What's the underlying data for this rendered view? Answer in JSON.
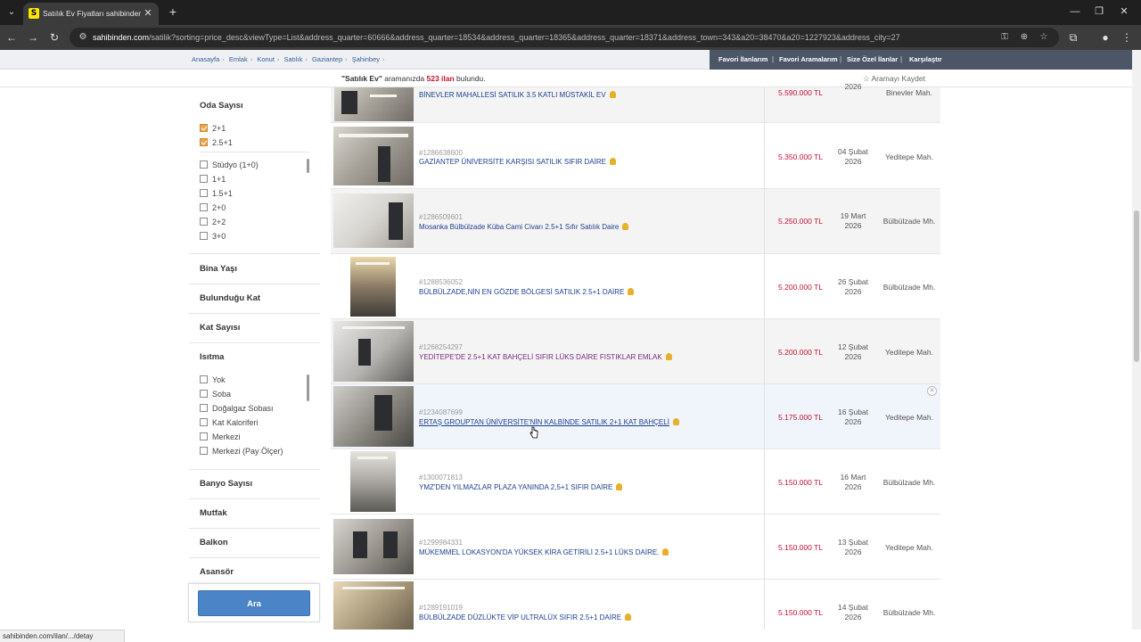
{
  "browser": {
    "tab_title": "Satılık Ev Fiyatları sahibinden.com",
    "url_host": "sahibinden.com",
    "url_rest": "/satilik?sorting=price_desc&viewType=List&address_quarter=60666&address_quarter=18534&address_quarter=18365&address_quarter=18371&address_town=343&a20=38470&a20=1227923&address_city=27",
    "status_url": "sahibinden.com/ilan/.../detay"
  },
  "breadcrumb": [
    "Anasayfa",
    "Emlak",
    "Konut",
    "Satılık",
    "Gaziantep",
    "Şahinbey"
  ],
  "user_links": [
    "Favori İlanlarım",
    "Favori Aramalarım",
    "Size Özel İlanlar",
    "Karşılaştır"
  ],
  "result": {
    "query": "\"Satılık Ev\"",
    "mid": " aramanızda ",
    "count": "523 ilan",
    "suffix": " bulundu.",
    "save_label": "Aramayı Kaydet"
  },
  "sidebar": {
    "room_title": "Oda Sayısı",
    "room_checked": [
      "2+1",
      "2.5+1"
    ],
    "room_options": [
      "Stüdyo (1+0)",
      "1+1",
      "1.5+1",
      "2+0",
      "2+2",
      "3+0"
    ],
    "sections": [
      "Bina Yaşı",
      "Bulunduğu Kat",
      "Kat Sayısı"
    ],
    "heating_title": "Isıtma",
    "heating_options": [
      "Yok",
      "Soba",
      "Doğalgaz Sobası",
      "Kat Kaloriferi",
      "Merkezi",
      "Merkezi (Pay Ölçer)"
    ],
    "sections2": [
      "Banyo Sayısı",
      "Mutfak",
      "Balkon",
      "Asansör"
    ],
    "search_button": "Ara"
  },
  "listings": [
    {
      "id": "",
      "title": "BİNEVLER MAHALLESİ SATILIK 3.5 KATLI MÜSTAKİL EV",
      "price": "5.590.000 TL",
      "date": [
        "",
        "2026"
      ],
      "location": "Binevler Mah."
    },
    {
      "id": "#1286638600",
      "title": "GAZİANTEP ÜNİVERSİTE KARŞISI SATILIK SIFIR DAİRE",
      "price": "5.350.000 TL",
      "date": [
        "04 Şubat",
        "2026"
      ],
      "location": "Yeditepe Mah."
    },
    {
      "id": "#1286509601",
      "title": "Mosanka Bülbülzade Küba Cami Civarı 2.5+1 Sıfır Satılık Daire",
      "price": "5.250.000 TL",
      "date": [
        "19 Mart",
        "2026"
      ],
      "location": "Bülbülzade Mh."
    },
    {
      "id": "#1288536052",
      "title": "BÜLBÜLZADE,NİN EN GÖZDE BÖLGESİ SATILIK 2.5+1 DAİRE",
      "price": "5.200.000 TL",
      "date": [
        "26 Şubat",
        "2026"
      ],
      "location": "Bülbülzade Mh."
    },
    {
      "id": "#1268254297",
      "title": "YEDİTEPE'DE 2.5+1 KAT BAHÇELİ SIFIR LÜKS DAİRE FISTIKLAR EMLAK",
      "price": "5.200.000 TL",
      "date": [
        "12 Şubat",
        "2026"
      ],
      "location": "Yeditepe Mah."
    },
    {
      "id": "#1234087699",
      "title": "ERTAŞ GROUPTAN ÜNİVERSİTE'NİN KALBİNDE SATILIK 2+1 KAT BAHÇELİ",
      "price": "5.175.000 TL",
      "date": [
        "16 Şubat",
        "2026"
      ],
      "location": "Yeditepe Mah."
    },
    {
      "id": "#1300071813",
      "title": "YMZ'DEN YILMAZLAR PLAZA YANINDA 2,5+1 SIFIR DAİRE",
      "price": "5.150.000 TL",
      "date": [
        "16 Mart",
        "2026"
      ],
      "location": "Bülbülzade Mh."
    },
    {
      "id": "#1299984331",
      "title": "MÜKEMMEL LOKASYON'DA YÜKSEK KİRA GETİRİLİ 2.5+1 LÜKS DAİRE.",
      "price": "5.150.000 TL",
      "date": [
        "13 Şubat",
        "2026"
      ],
      "location": "Yeditepe Mah."
    },
    {
      "id": "#1289191019",
      "title": "BÜLBÜLZADE DÜZLÜKTE VİP ULTRALÜX SIFIR 2.5+1 DAİRE",
      "price": "5.150.000 TL",
      "date": [
        "14 Şubat",
        "2026"
      ],
      "location": "Bülbülzade Mh."
    }
  ],
  "colors": {
    "price": "#c4122f",
    "link": "#1d3f8f",
    "visited": "#7a2a7a",
    "search_button": "#4b84c7"
  }
}
